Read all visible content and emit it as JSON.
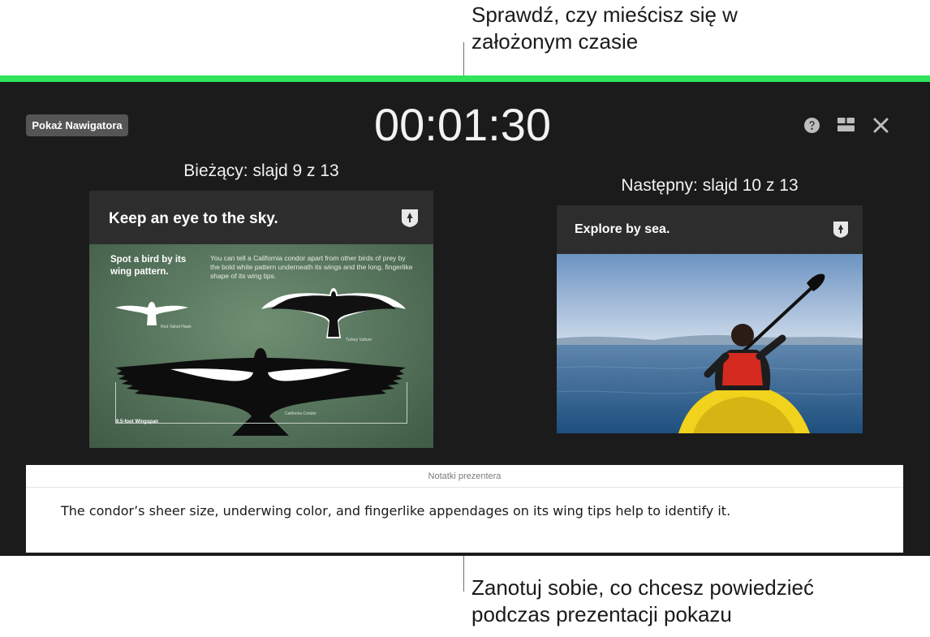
{
  "callouts": {
    "top_line1": "Sprawdź, czy mieścisz się w",
    "top_line2": "założonym czasie",
    "bottom_line1": "Zanotuj sobie, co chcesz powiedzieć",
    "bottom_line2": "podczas prezentacji pokazu"
  },
  "presenter": {
    "timer_bar_color": "#2fe35a",
    "show_navigator_label": "Pokaż Nawigatora",
    "timer": "00:01:30",
    "icons": [
      "help-icon",
      "layout-icon",
      "close-icon"
    ]
  },
  "current_slide": {
    "label": "Bieżący: slajd 9 z 13",
    "title": "Keep an eye to the sky.",
    "heading": "Spot a bird by its wing pattern.",
    "paragraph": "You can tell a California condor apart from other birds of prey by the bold white pattern underneath its wings and the long, fingerlike shape of its wing tips.",
    "bird_labels": {
      "hawk": "Red-Tailed Hawk",
      "vulture": "Turkey Vulture",
      "condor": "California Condor",
      "wingspan": "9.5-foot Wingspan"
    }
  },
  "next_slide": {
    "label": "Następny: slajd 10 z 13",
    "title": "Explore by sea."
  },
  "notes": {
    "header": "Notatki prezentera",
    "text": "The condor’s sheer size, underwing color, and fingerlike appendages on its wing tips help to identify it."
  }
}
